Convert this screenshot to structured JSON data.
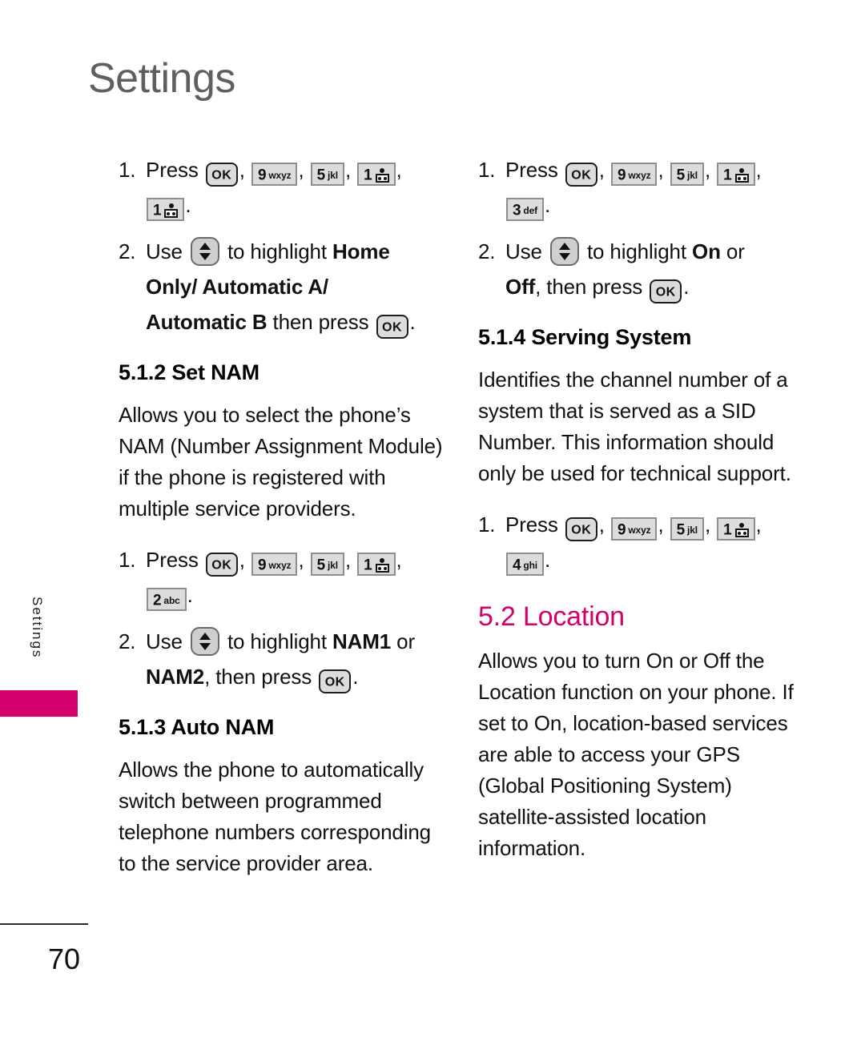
{
  "page": {
    "header_title": "Settings",
    "side_tab_label": "Settings",
    "page_number": "70",
    "accent_color": "#d6006c",
    "header_color": "#5f5f5f"
  },
  "keys": {
    "ok": {
      "label": "OK",
      "name": "ok-key"
    },
    "nav": {
      "label": "up-down",
      "name": "navigation-up-down-key"
    },
    "k1": {
      "digit": "1",
      "letters": "",
      "icon": "voicemail-icon"
    },
    "k2": {
      "digit": "2",
      "letters": "abc"
    },
    "k3": {
      "digit": "3",
      "letters": "def"
    },
    "k4": {
      "digit": "4",
      "letters": "ghi"
    },
    "k5": {
      "digit": "5",
      "letters": "jkl"
    },
    "k9": {
      "digit": "9",
      "letters": "wxyz"
    }
  },
  "left_column": {
    "step1": {
      "number": "1.",
      "verb": "Press",
      "comma": ",",
      "period": "."
    },
    "step2": {
      "number": "2.",
      "verb": "Use",
      "mid": "to highlight",
      "bold1": "Home",
      "bold2": "Only/ Automatic A/",
      "bold3": "Automatic B",
      "tail": "then press",
      "period": "."
    },
    "heading_512": "5.1.2 Set NAM",
    "body_512": "Allows you to select the phone’s NAM (Number Assignment Module) if the phone is registered with multiple service providers.",
    "step1b": {
      "number": "1.",
      "verb": "Press",
      "period": "."
    },
    "step2b": {
      "number": "2.",
      "verb": "Use",
      "mid": "to highlight",
      "bold1": "NAM1",
      "or": "or",
      "bold2": "NAM2",
      "tail": ", then press",
      "period": "."
    },
    "heading_513": "5.1.3 Auto NAM",
    "body_513": "Allows the phone to automatically switch between programmed telephone numbers corresponding to the service provider area."
  },
  "right_column": {
    "step1": {
      "number": "1.",
      "verb": "Press",
      "period": "."
    },
    "step2": {
      "number": "2.",
      "verb": "Use",
      "mid": "to highlight",
      "bold1": "On",
      "or": "or",
      "bold2": "Off",
      "tail": ", then press",
      "period": "."
    },
    "heading_514": "5.1.4 Serving System",
    "body_514": "Identifies the channel number of a system that is served as a SID Number. This information should only be used for technical support.",
    "step1b": {
      "number": "1.",
      "verb": "Press",
      "period": "."
    },
    "heading_52": "5.2 Location",
    "body_52": "Allows you to turn On or Off the Location function on your phone. If set to On, location-based services are able to access your GPS (Global Positioning System) satellite-assisted location information."
  },
  "punct": {
    "comma": ",",
    "period": "."
  }
}
